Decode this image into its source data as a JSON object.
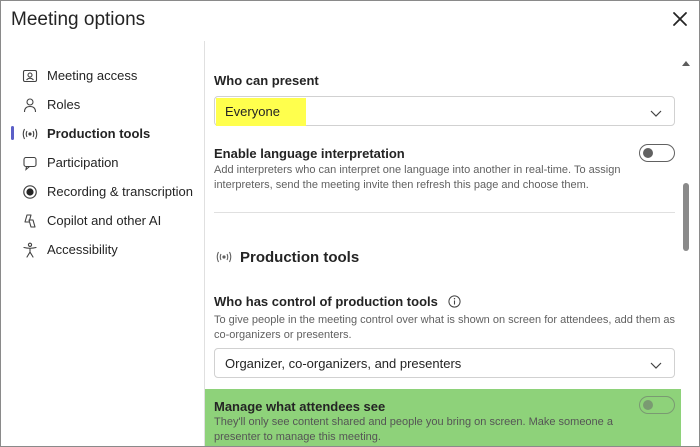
{
  "window": {
    "title": "Meeting options",
    "icons": {
      "close": "close-icon"
    }
  },
  "sidebar": {
    "items": [
      {
        "label": "Meeting access",
        "icon": "person-card-icon",
        "active": false
      },
      {
        "label": "Roles",
        "icon": "person-icon",
        "active": false
      },
      {
        "label": "Production tools",
        "icon": "broadcast-icon",
        "active": true
      },
      {
        "label": "Participation",
        "icon": "chat-icon",
        "active": false
      },
      {
        "label": "Recording & transcription",
        "icon": "record-icon",
        "active": false
      },
      {
        "label": "Copilot and other AI",
        "icon": "copilot-icon",
        "active": false
      },
      {
        "label": "Accessibility",
        "icon": "accessibility-icon",
        "active": false
      }
    ],
    "accent_color": "#5b5fc7"
  },
  "main": {
    "who_can_present": {
      "label": "Who can present",
      "value": "Everyone",
      "highlight_color": "#ffff4d"
    },
    "language_interpretation": {
      "label": "Enable language interpretation",
      "description": "Add interpreters who can interpret one language into another in real-time. To assign interpreters, send the meeting invite then refresh this page and choose them.",
      "enabled": false
    },
    "production_tools": {
      "heading": "Production tools",
      "control_label": "Who has control of production tools",
      "control_description": "To give people in the meeting control over what is shown on screen for attendees, add them as co-organizers or presenters.",
      "control_value": "Organizer, co-organizers, and presenters"
    },
    "manage_attendees": {
      "label": "Manage what attendees see",
      "description": "They'll only see content shared and people you bring on screen. Make someone a presenter to manage this meeting.",
      "enabled": false,
      "highlight_color": "#8ed27a"
    }
  }
}
